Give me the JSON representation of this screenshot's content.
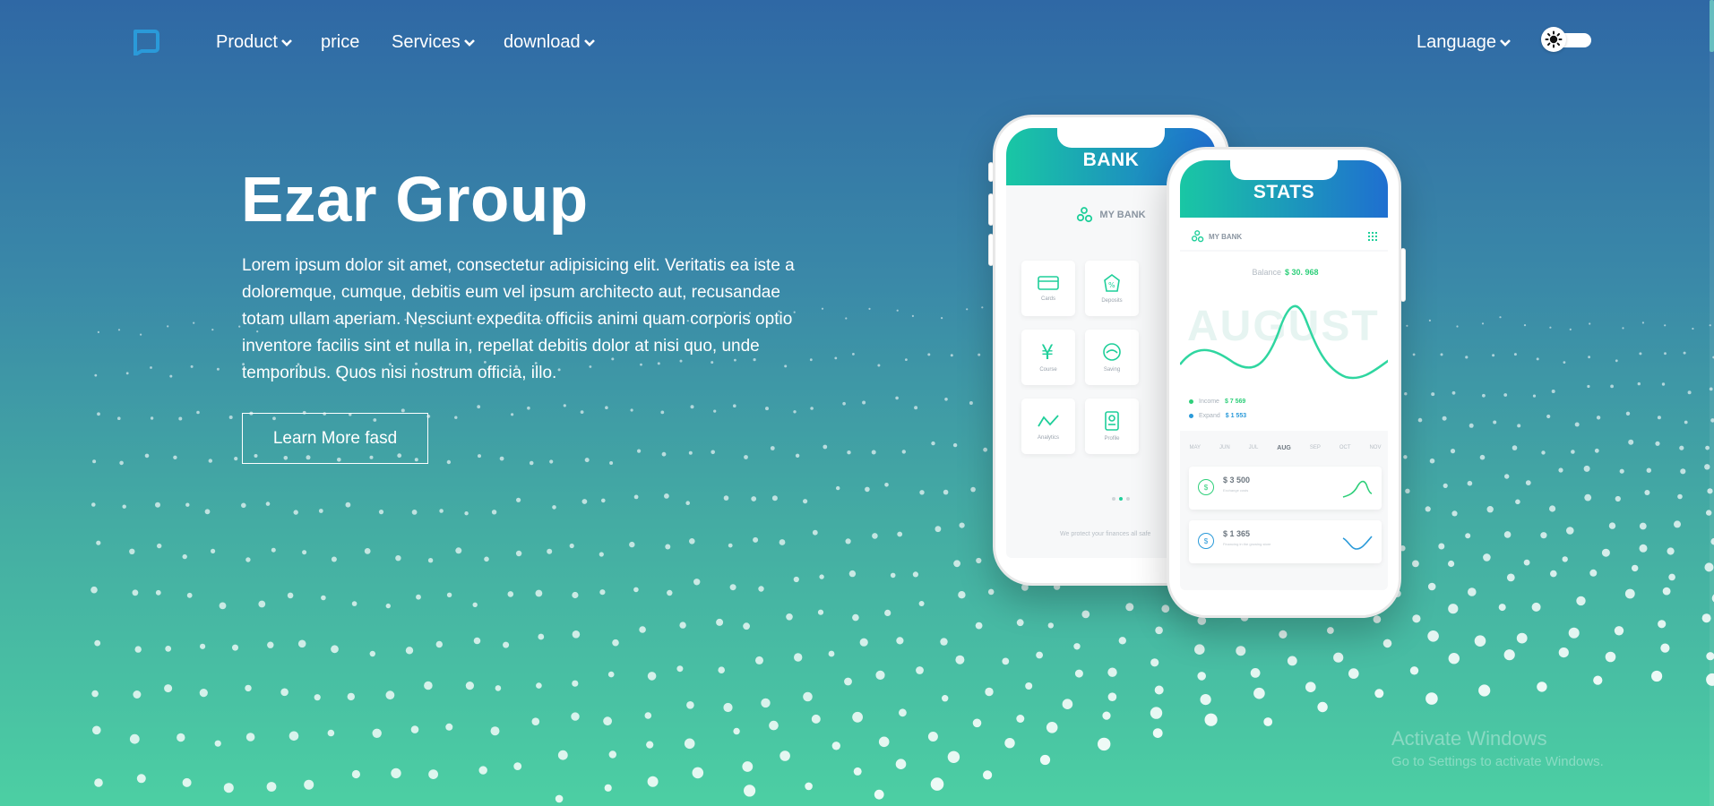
{
  "nav": {
    "items": [
      {
        "label": "Product",
        "has_dropdown": true
      },
      {
        "label": "price",
        "has_dropdown": false
      },
      {
        "label": "Services",
        "has_dropdown": true
      },
      {
        "label": "download",
        "has_dropdown": true
      }
    ],
    "language_label": "Language",
    "logo_icon": "chat-bubble-logo-icon",
    "theme_toggle_icon": "sun-icon"
  },
  "hero": {
    "title": "Ezar Group",
    "description": "Lorem ipsum dolor sit amet, consectetur adipisicing elit. Veritatis ea iste a doloremque, cumque, debitis eum vel ipsum architecto aut, recusandae totam ullam aperiam. Nesciunt expedita officiis animi quam corporis optio inventore facilis sint et nulla in, repellat debitis dolor at nisi quo, unde temporibus. Quos nisi nostrum officia, illo.",
    "cta_label": "Learn More fasd"
  },
  "bank_phone": {
    "header": "BANK",
    "brand": "MY BANK",
    "tiles": [
      {
        "label": "Cards",
        "icon": "card-icon"
      },
      {
        "label": "Deposits",
        "icon": "piggy-bank-icon"
      },
      {
        "label": "Course",
        "icon": "yen-icon"
      },
      {
        "label": "Saving",
        "icon": "saving-icon"
      },
      {
        "label": "Analytics",
        "icon": "analytics-icon"
      },
      {
        "label": "Profile",
        "icon": "profile-icon"
      }
    ],
    "footer": "We protect your finances all safe"
  },
  "stats_phone": {
    "header": "STATS",
    "brand": "MY BANK",
    "balance_label": "Balance",
    "balance_value": "$ 30. 968",
    "watermark": "AUGUST",
    "legend": [
      {
        "label": "Income",
        "value": "$ 7 569",
        "color": "#2ecf7a"
      },
      {
        "label": "Expand",
        "value": "$ 1 553",
        "color": "#2a9ad9"
      }
    ],
    "months": [
      "MAY",
      "JUN",
      "JUL",
      "AUG",
      "SEP",
      "OCT",
      "NOV"
    ],
    "active_month": "AUG",
    "transactions": [
      {
        "amount": "$ 3 500",
        "sub": "Exchange costs",
        "color": "#2ecf7a"
      },
      {
        "amount": "$ 1 365",
        "sub": "Financing in the growing store",
        "color": "#2a9ad9"
      }
    ]
  },
  "system": {
    "activate_title": "Activate Windows",
    "activate_sub": "Go to Settings to activate Windows."
  },
  "colors": {
    "bg_top": "#2f68a5",
    "bg_bottom": "#4ccfa3",
    "accent_green": "#1fcf9a",
    "accent_blue": "#1f6fd0"
  }
}
